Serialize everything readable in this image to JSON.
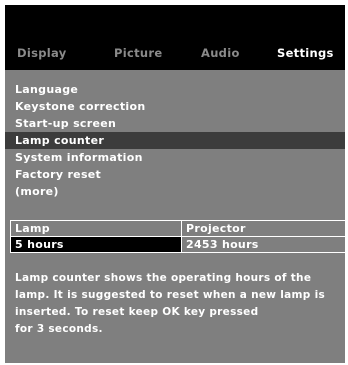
{
  "tabs": [
    {
      "label": "Display"
    },
    {
      "label": "Picture"
    },
    {
      "label": "Audio"
    },
    {
      "label": "Settings"
    }
  ],
  "menu": {
    "items": [
      {
        "label": "Language"
      },
      {
        "label": "Keystone correction"
      },
      {
        "label": "Start-up screen"
      },
      {
        "label": "Lamp counter"
      },
      {
        "label": "System information"
      },
      {
        "label": "Factory reset"
      },
      {
        "label": "(more)"
      }
    ],
    "selected": "Lamp counter"
  },
  "lamp_table": {
    "headers": [
      "Lamp",
      "Projector"
    ],
    "values": [
      "5 hours",
      "2453 hours"
    ]
  },
  "description": {
    "lines": [
      "Lamp counter shows the operating hours of the",
      "lamp. It is suggested to reset when a new lamp is",
      "inserted. To reset keep OK key pressed",
      "for 3 seconds."
    ]
  },
  "colors": {
    "panel_background": "#7f7f7f",
    "header_background": "#000000",
    "selected_row": "#3c3c3c",
    "inactive_tab": "#8a8a8a",
    "text": "#ffffff"
  }
}
